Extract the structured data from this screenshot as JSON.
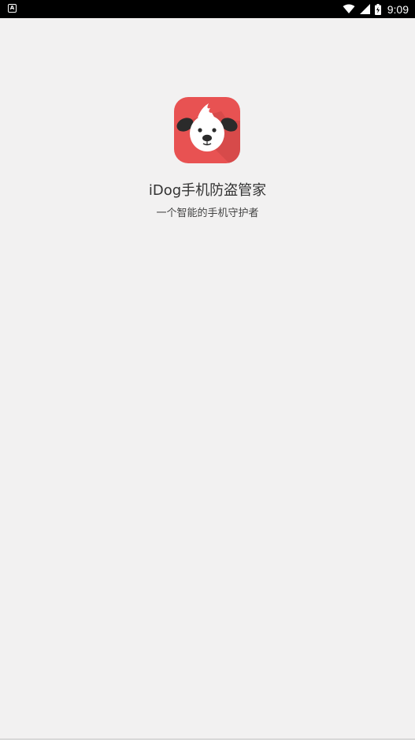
{
  "status_bar": {
    "notification_icon": "a-badge-icon",
    "notification_letter": "A",
    "icons": [
      "wifi-icon",
      "signal-icon",
      "battery-icon"
    ],
    "time": "9:09"
  },
  "app": {
    "icon": "dog-face-icon",
    "title": "iDog手机防盗管家",
    "subtitle": "一个智能的手机守护者"
  },
  "colors": {
    "background": "#f2f1f1",
    "status_bar": "#000000",
    "icon_red": "#e85252",
    "icon_shadow": "#c84444",
    "title_text": "#333333"
  }
}
